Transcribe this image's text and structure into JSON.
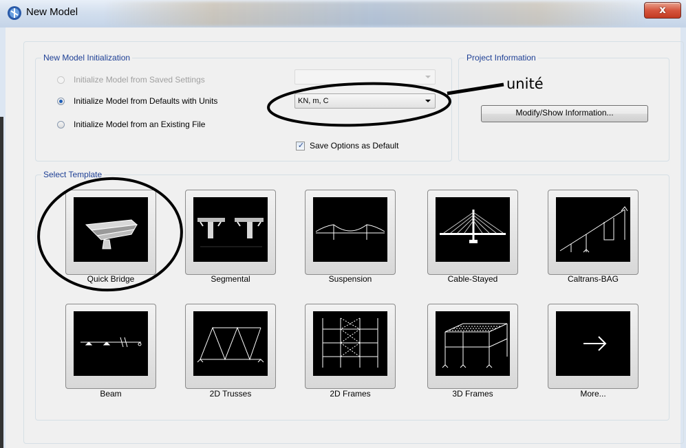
{
  "window": {
    "title": "New Model",
    "close_glyph": "x"
  },
  "init_group": {
    "title": "New Model Initialization",
    "options": [
      {
        "label": "Initialize Model from Saved Settings",
        "checked": false,
        "enabled": false
      },
      {
        "label": "Initialize Model from Defaults with Units",
        "checked": true,
        "enabled": true
      },
      {
        "label": "Initialize Model from an Existing File",
        "checked": false,
        "enabled": true
      }
    ],
    "saved_settings_value": "",
    "units_value": "KN, m, C",
    "save_default": {
      "label": "Save Options as Default",
      "checked": true
    }
  },
  "project_group": {
    "title": "Project Information",
    "button_label": "Modify/Show Information..."
  },
  "annotation": {
    "text": "unité"
  },
  "template_group": {
    "title": "Select Template",
    "tiles": [
      {
        "label": "Quick Bridge",
        "icon": "quick-bridge-icon"
      },
      {
        "label": "Segmental",
        "icon": "segmental-icon"
      },
      {
        "label": "Suspension",
        "icon": "suspension-icon"
      },
      {
        "label": "Cable-Stayed",
        "icon": "cable-stayed-icon"
      },
      {
        "label": "Caltrans-BAG",
        "icon": "caltrans-bag-icon"
      },
      {
        "label": "Beam",
        "icon": "beam-icon"
      },
      {
        "label": "2D Trusses",
        "icon": "2d-trusses-icon"
      },
      {
        "label": "2D Frames",
        "icon": "2d-frames-icon"
      },
      {
        "label": "3D Frames",
        "icon": "3d-frames-icon"
      },
      {
        "label": "More...",
        "icon": "arrow-right-icon"
      }
    ]
  }
}
